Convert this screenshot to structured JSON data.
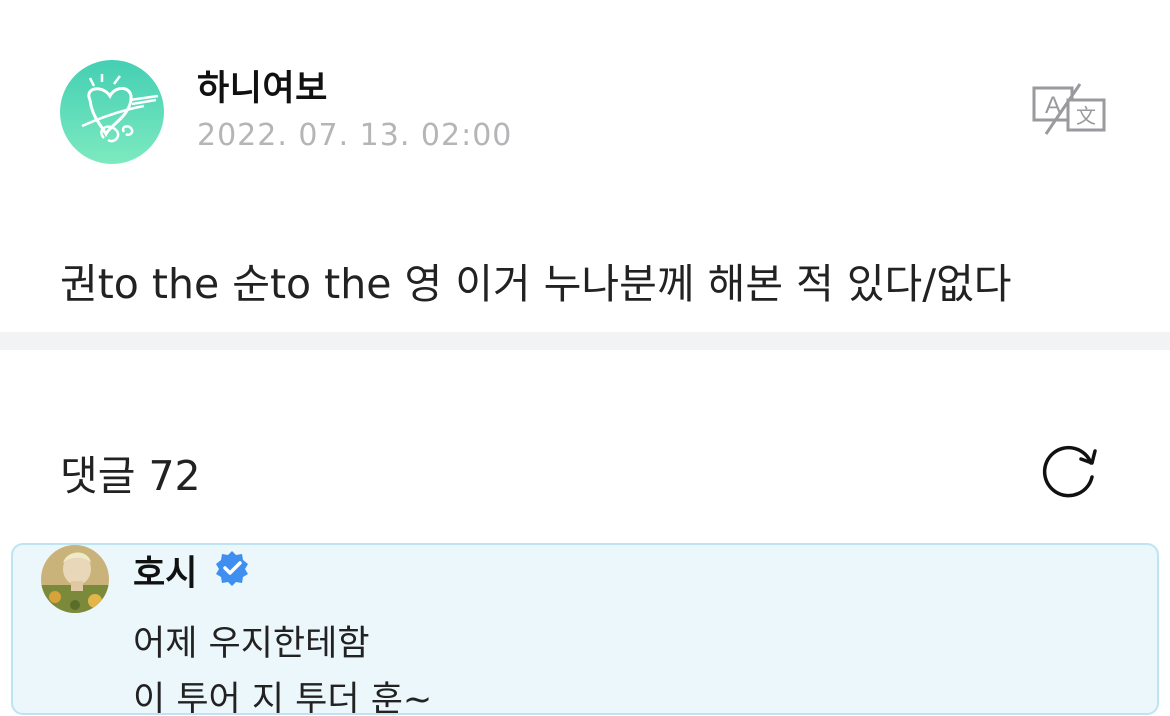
{
  "post": {
    "author_name": "하니여보",
    "timestamp": "2022. 07. 13. 02:00",
    "body": "권to the 순to the 영 이거 누나분께 해본 적 있다/없다",
    "translate_icon": "translate-icon"
  },
  "comments": {
    "title": "댓글 72",
    "refresh_icon": "refresh-icon",
    "items": [
      {
        "author": "호시",
        "verified": true,
        "lines": [
          "어제 우지한테함",
          "이 투어 지 투더 훈~"
        ]
      }
    ]
  },
  "colors": {
    "avatar_gradient_top": "#44cfb3",
    "avatar_gradient_bottom": "#7deac0",
    "timestamp_gray": "#b5b5b8",
    "divider": "#f2f3f5",
    "highlight_bg": "#ecf7fc",
    "highlight_border": "#bde4f2",
    "verified_blue": "#3f8ff0"
  }
}
